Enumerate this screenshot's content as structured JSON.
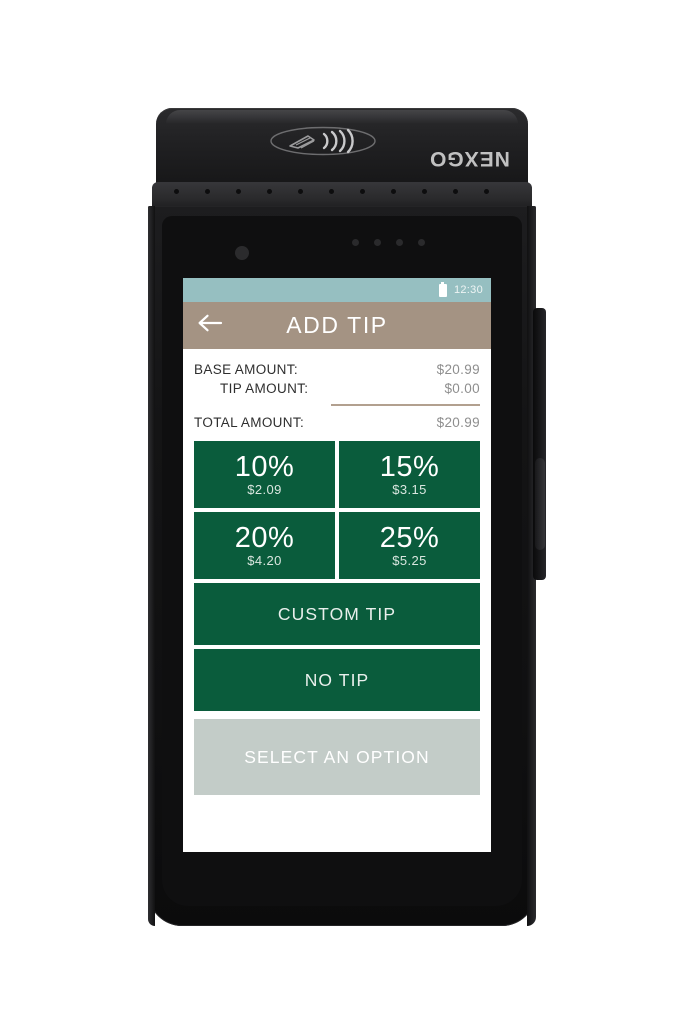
{
  "device": {
    "brand": "NEXGO",
    "nfc_icon": "contactless-nfc-icon"
  },
  "status_bar": {
    "time": "12:30",
    "battery_icon": "battery-icon"
  },
  "app_bar": {
    "title": "ADD TIP",
    "back_icon": "back-arrow-icon"
  },
  "amounts": {
    "base_label": "BASE AMOUNT:",
    "base_value": "$20.99",
    "tip_label": "TIP AMOUNT:",
    "tip_value": "$0.00",
    "total_label": "TOTAL AMOUNT:",
    "total_value": "$20.99"
  },
  "tip_options": [
    {
      "percent": "10%",
      "amount": "$2.09"
    },
    {
      "percent": "15%",
      "amount": "$3.15"
    },
    {
      "percent": "20%",
      "amount": "$4.20"
    },
    {
      "percent": "25%",
      "amount": "$5.25"
    }
  ],
  "actions": {
    "custom_tip": "CUSTOM TIP",
    "no_tip": "NO TIP",
    "select_an_option": "SELECT AN OPTION"
  },
  "colors": {
    "accent_green": "#0a5c3c",
    "app_bar_taupe": "#a49383",
    "status_teal": "#96bfc1",
    "disabled_gray": "#c3ccc8",
    "divider_tan": "#b2a08f"
  }
}
